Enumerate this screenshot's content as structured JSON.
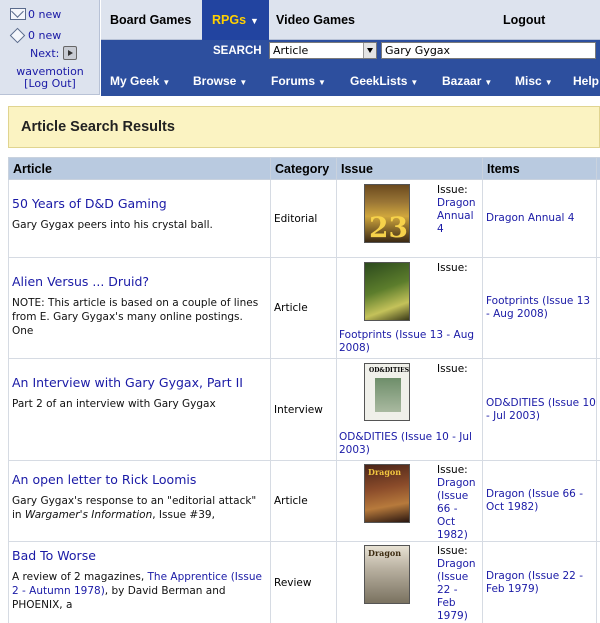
{
  "user": {
    "messages_count": "0 new",
    "tags_count": "0 new",
    "next_label": "Next:",
    "username": "wavemotion",
    "logout_link": "[Log Out]"
  },
  "topnav": {
    "board_games": "Board Games",
    "rpgs": "RPGs",
    "video_games": "Video Games",
    "logout": "Logout"
  },
  "search": {
    "label": "SEARCH",
    "type_value": "Article",
    "query": "Gary Gygax"
  },
  "menu": [
    "My Geek",
    "Browse",
    "Forums",
    "GeekLists",
    "Bazaar",
    "Misc",
    "Help"
  ],
  "page_title": "Article Search Results",
  "table": {
    "headers": [
      "Article",
      "Category",
      "Issue",
      "Items"
    ],
    "rows": [
      {
        "title": "50 Years of D&D Gaming",
        "desc": "Gary Gygax peers into his crystal ball.",
        "category": "Editorial",
        "issue_prefix": "Issue:",
        "issue_link": "Dragon Annual 4",
        "items": "Dragon Annual 4"
      },
      {
        "title": "Alien Versus ... Druid?",
        "desc": "NOTE: This article is based on a couple of lines from E. Gary Gygax's many online postings. One",
        "category": "Article",
        "issue_prefix": "Issue:",
        "issue_link": "Footprints (Issue 13 - Aug 2008)",
        "items": "Footprints (Issue 13 - Aug 2008)"
      },
      {
        "title": "An Interview with Gary Gygax, Part II",
        "desc": "Part 2 of an interview with Gary Gygax",
        "category": "Interview",
        "issue_prefix": "Issue:",
        "issue_link": "OD&DITIES (Issue 10 - Jul 2003)",
        "items": "OD&DITIES (Issue 10 - Jul 2003)"
      },
      {
        "title": "An open letter to Rick Loomis",
        "desc_before": "Gary Gygax's response to an \"editorial attack\" in ",
        "desc_italic": "Wargamer's Information",
        "desc_after": ", Issue #39,",
        "category": "Article",
        "issue_prefix": "Issue:",
        "issue_link": "Dragon (Issue 66 - Oct 1982)",
        "items": "Dragon (Issue 66 - Oct 1982)"
      },
      {
        "title": "Bad To Worse",
        "desc_before": "A review of 2 magazines, ",
        "desc_link": "The Apprentice (Issue 2 - Autumn 1978)",
        "desc_after": ", by David Berman and PHOENIX, a",
        "category": "Review",
        "issue_prefix": "Issue:",
        "issue_link": "Dragon (Issue 22 - Feb 1979)",
        "items": "Dragon (Issue 22 - Feb 1979)"
      }
    ]
  },
  "covers": {
    "annual_big": "23",
    "oddities_header": "OD&DITIES",
    "dragon_header": "Dragon"
  }
}
